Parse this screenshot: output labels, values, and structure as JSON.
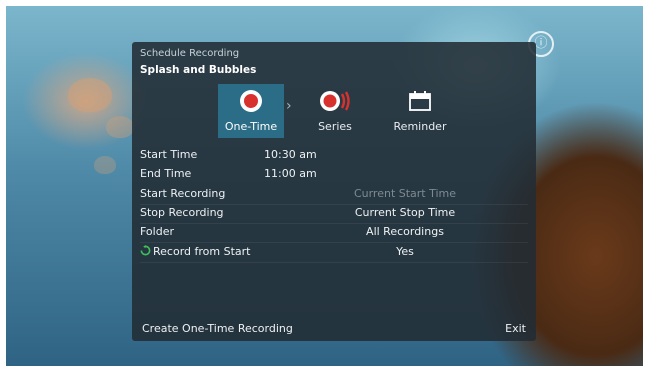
{
  "header": {
    "subtitle": "Schedule Recording",
    "program_title": "Splash and Bubbles"
  },
  "options": [
    {
      "label": "One-Time",
      "icon": "record-dot-icon",
      "selected": true
    },
    {
      "label": "Series",
      "icon": "series-record-icon",
      "selected": false
    },
    {
      "label": "Reminder",
      "icon": "calendar-icon",
      "selected": false
    }
  ],
  "details": {
    "start_time_label": "Start Time",
    "start_time_value": "10:30 am",
    "end_time_label": "End Time",
    "end_time_value": "11:00 am",
    "start_recording_label": "Start Recording",
    "start_recording_value": "Current Start Time",
    "stop_recording_label": "Stop Recording",
    "stop_recording_value": "Current Stop Time",
    "folder_label": "Folder",
    "folder_value": "All Recordings",
    "record_from_start_label": "Record from Start",
    "record_from_start_value": "Yes"
  },
  "footer": {
    "create_label": "Create One-Time Recording",
    "exit_label": "Exit"
  },
  "colors": {
    "record_red": "#d8322e",
    "selected_highlight": "#2b6c86",
    "panel_bg": "#222c34",
    "restart_green": "#3fbf5a"
  }
}
